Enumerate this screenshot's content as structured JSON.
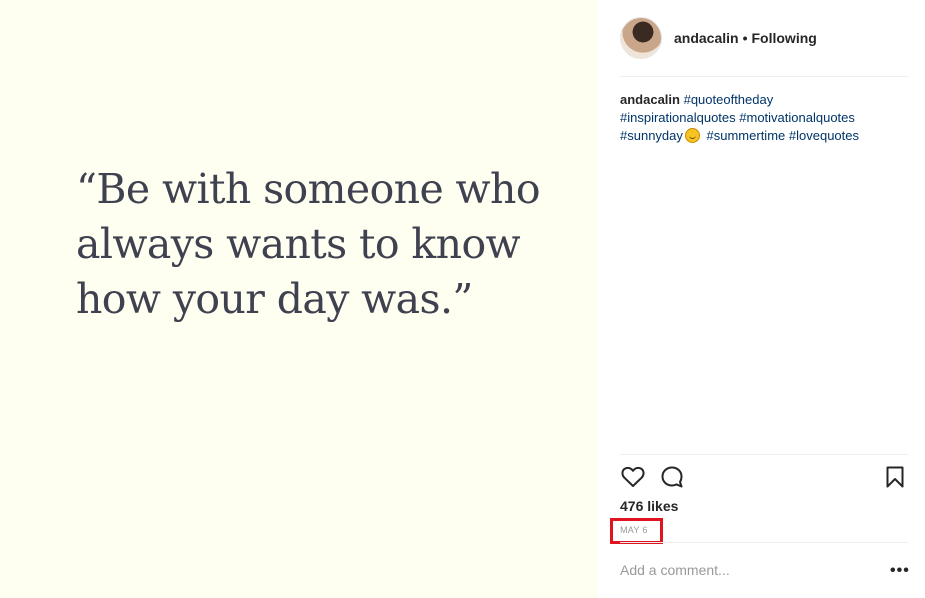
{
  "post_image": {
    "quote_lines": [
      "“Be with someone who",
      "always wants to know",
      "how your day was.”"
    ],
    "background": "#fefff0"
  },
  "header": {
    "username": "andacalin",
    "separator": "•",
    "follow_state": "Following"
  },
  "caption": {
    "username": "andacalin",
    "tags_line1": [
      "#quoteoftheday"
    ],
    "tags_line2": [
      "#inspirationalquotes",
      "#motivationalquotes"
    ],
    "tags_line3_before_emoji": [
      "#sunnyday"
    ],
    "emoji": "sun-emoji",
    "tags_line3_after_emoji": [
      "#summertime",
      "#lovequotes"
    ]
  },
  "actions": {
    "like_icon": "heart-icon",
    "comment_icon": "comment-bubble-icon",
    "save_icon": "bookmark-icon"
  },
  "likes": "476 likes",
  "date": "MAY 6",
  "comment": {
    "placeholder": "Add a comment...",
    "more_label": "•••"
  },
  "colors": {
    "hashtag": "#003569",
    "highlight": "#e0141e"
  }
}
